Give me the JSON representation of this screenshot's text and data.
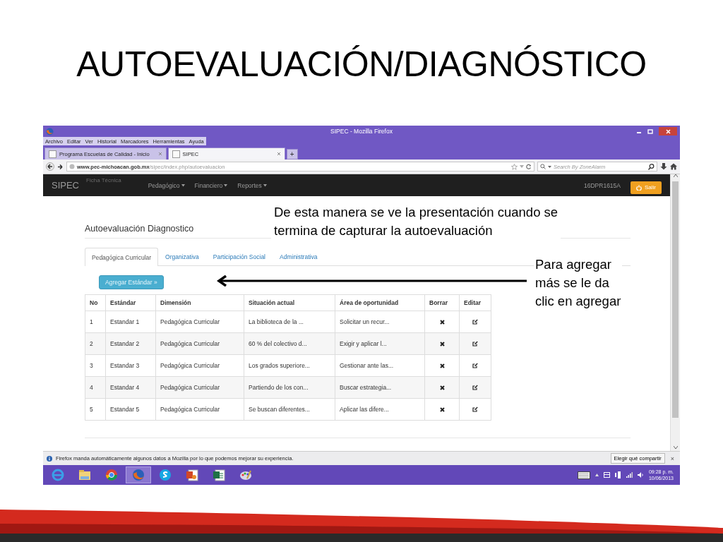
{
  "slide": {
    "title": "AUTOEVALUACIÓN/DIAGNÓSTICO"
  },
  "annotations": [
    {
      "lines": [
        "De esta manera se ve la presentación cuando se",
        "termina de capturar la autoevaluación"
      ]
    },
    {
      "lines": [
        "Para agregar",
        "más se le da",
        "clic en agregar"
      ]
    }
  ],
  "browser": {
    "window_title": "SIPEC - Mozilla Firefox",
    "menu": [
      "Archivo",
      "Editar",
      "Ver",
      "Historial",
      "Marcadores",
      "Herramientas",
      "Ayuda"
    ],
    "tabs": [
      {
        "label": "Programa Escuelas de Calidad - Inicio",
        "selected": false
      },
      {
        "label": "SIPEC",
        "selected": true
      }
    ],
    "new_tab": "+",
    "url_host": "www.pec-michoacan.gob.mx",
    "url_path": "/sipec/index.php/autoevaluacion",
    "search_placeholder": "Search By ZoneAlarm"
  },
  "app": {
    "brand": "SIPEC",
    "faint_link": "Ficha Técnica",
    "menus": [
      "Pedagógico",
      "Financiero",
      "Reportes"
    ],
    "user": "16DPR1615A",
    "logout": "Salir",
    "heading": "Autoevaluación Diagnostico",
    "tabs": [
      {
        "label": "Pedagógica Curricular",
        "selected": true
      },
      {
        "label": "Organizativa",
        "selected": false
      },
      {
        "label": "Participación Social",
        "selected": false
      },
      {
        "label": "Administrativa",
        "selected": false
      }
    ],
    "add_button": "Agregar Estándar »",
    "table": {
      "columns": [
        "No",
        "Estándar",
        "Dimensión",
        "Situación actual",
        "Área de oportunidad",
        "Borrar",
        "Editar"
      ],
      "rows": [
        {
          "cells": [
            "1",
            "Estandar  1",
            "Pedagógica Curricular",
            "La biblioteca de la ...",
            "Solicitar un recur..."
          ]
        },
        {
          "cells": [
            "2",
            "Estandar  2",
            "Pedagógica Curricular",
            "60 % del colectivo d...",
            "Exigir y aplicar l..."
          ]
        },
        {
          "cells": [
            "3",
            "Estandar  3",
            "Pedagógica Curricular",
            "Los grados superiore...",
            "Gestionar ante las..."
          ]
        },
        {
          "cells": [
            "4",
            "Estandar  4",
            "Pedagógica Curricular",
            "Partiendo de los con...",
            "Buscar estrategia..."
          ]
        },
        {
          "cells": [
            "5",
            "Estandar  5",
            "Pedagógica Curricular",
            "Se buscan diferentes...",
            "Aplicar las difere..."
          ]
        }
      ]
    }
  },
  "notification": {
    "text": "Firefox manda automáticamente algunos datos a Mozilla por lo que podemos mejorar su experiencia.",
    "button": "Elegir qué compartir",
    "close": "×"
  },
  "taskbar": {
    "apps": [
      {
        "kind": "ie",
        "selected": false
      },
      {
        "kind": "explorer",
        "selected": false
      },
      {
        "kind": "chrome",
        "selected": false
      },
      {
        "kind": "firefox",
        "selected": true
      },
      {
        "kind": "skype",
        "selected": false
      },
      {
        "kind": "powerpoint",
        "selected": false
      },
      {
        "kind": "excel",
        "selected": false
      },
      {
        "kind": "paint",
        "selected": false
      }
    ],
    "time": "09:28 p. m.",
    "date": "10/06/2013"
  }
}
